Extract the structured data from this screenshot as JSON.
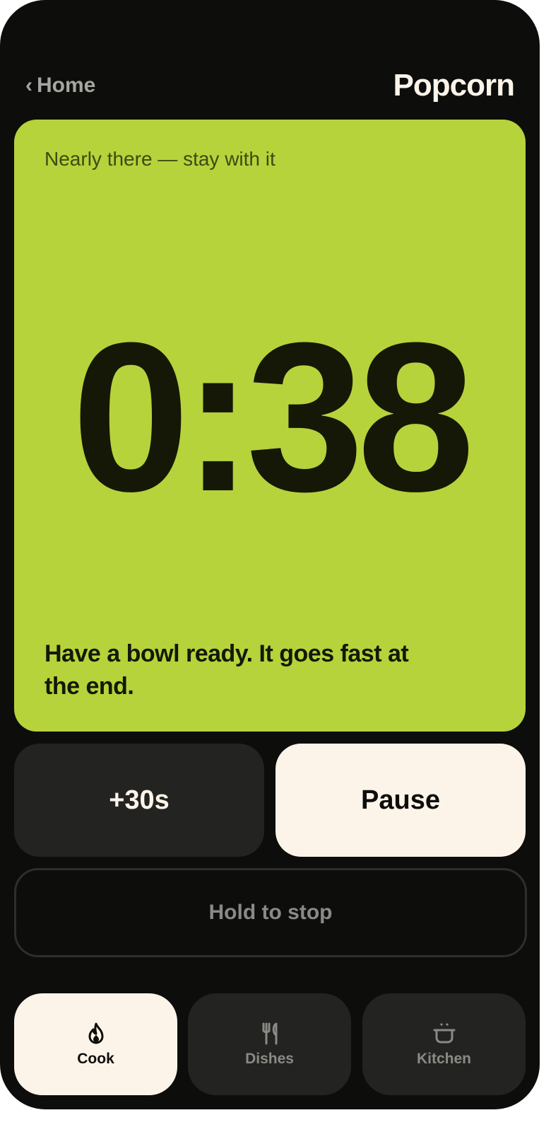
{
  "header": {
    "back_label": "Home",
    "title": "Popcorn"
  },
  "timer": {
    "status": "Nearly there — stay with it",
    "remaining": "0:38",
    "tip": "Have a bowl ready. It goes fast at the end."
  },
  "controls": {
    "add_time_label": "+30s",
    "pause_label": "Pause",
    "stop_label": "Hold to stop"
  },
  "tabs": [
    {
      "label": "Cook",
      "icon": "flame-icon",
      "active": true
    },
    {
      "label": "Dishes",
      "icon": "utensils-icon",
      "active": false
    },
    {
      "label": "Kitchen",
      "icon": "pot-icon",
      "active": false
    }
  ],
  "colors": {
    "background": "#0d0d0c",
    "accent": "#b6d33c",
    "cream": "#fdf4e9",
    "surface": "#232321"
  }
}
